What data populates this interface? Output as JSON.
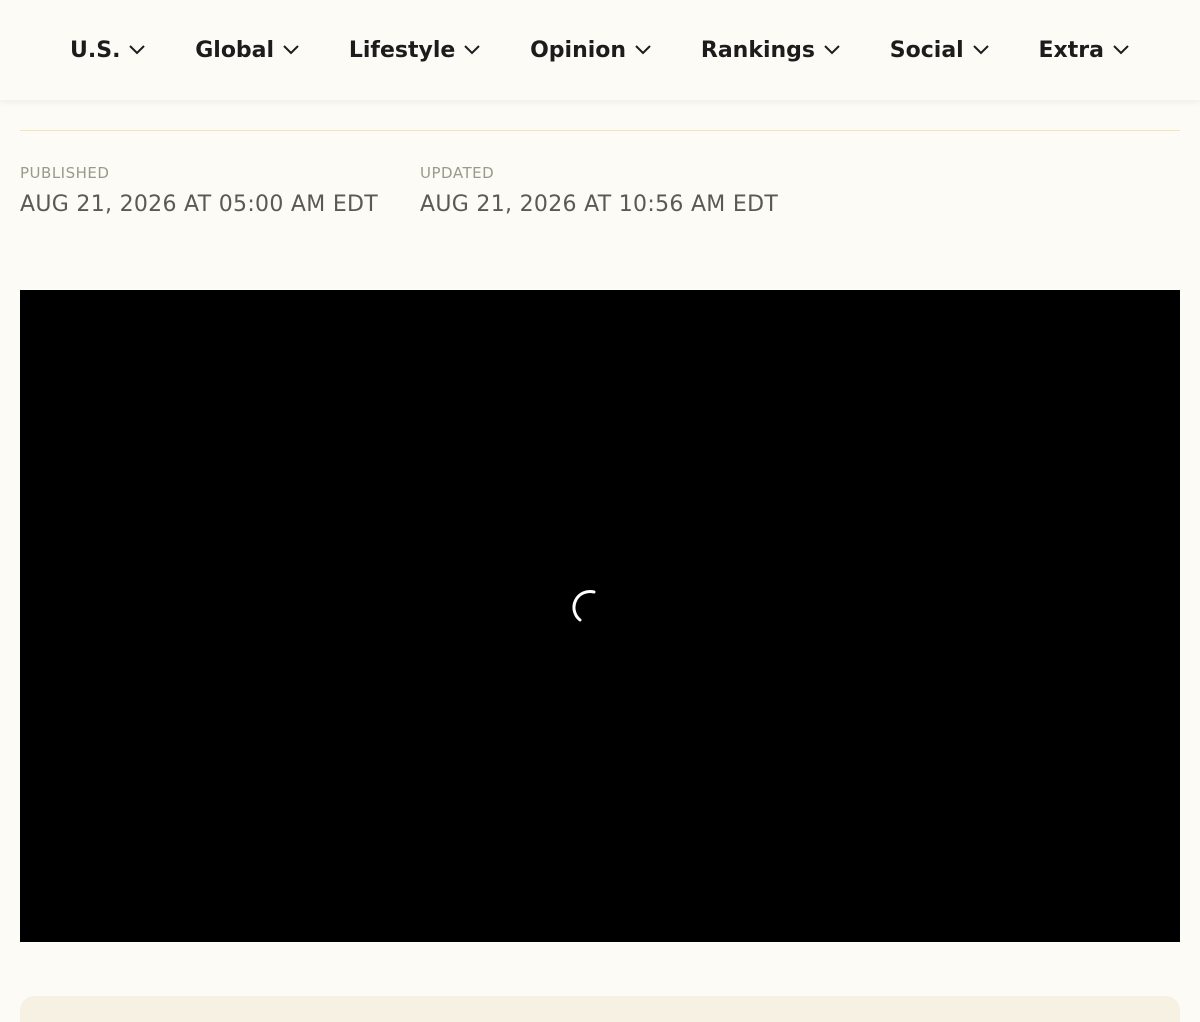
{
  "nav": {
    "items": [
      {
        "label": "U.S."
      },
      {
        "label": "Global"
      },
      {
        "label": "Lifestyle"
      },
      {
        "label": "Opinion"
      },
      {
        "label": "Rankings"
      },
      {
        "label": "Social"
      },
      {
        "label": "Extra"
      }
    ]
  },
  "meta": {
    "published_label": "PUBLISHED",
    "published_value": "AUG 21, 2026 AT 05:00 AM EDT",
    "updated_label": "UPDATED",
    "updated_value": "AUG 21, 2026 AT 10:56 AM EDT"
  },
  "video": {
    "state": "loading",
    "spinner_icon": "loading-spinner-icon"
  },
  "colors": {
    "background": "#fcfbf6",
    "video_bg": "#000000",
    "divider": "#efe3cc",
    "card": "#f6f1e3"
  }
}
